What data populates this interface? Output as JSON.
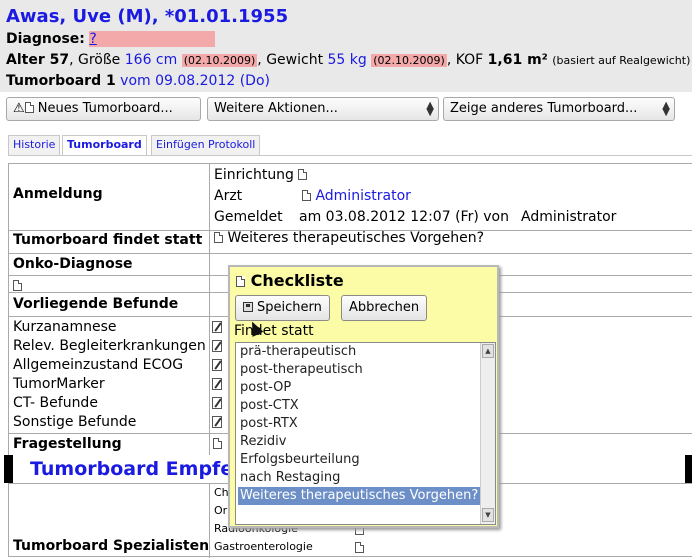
{
  "header": {
    "patient": "Awas, Uve (M), *01.01.1955",
    "diagnose_label": "Diagnose:",
    "diagnose_value": "?",
    "alter_label": "Alter 57",
    "groesse_label": ", Größe",
    "groesse_value": "166 cm",
    "groesse_date": "(02.10.2009)",
    "gewicht_label": ", Gewicht",
    "gewicht_value": "55 kg",
    "gewicht_date": "(02.10.2009)",
    "kof_label": ", KOF",
    "kof_value": "1,61 m²",
    "kof_note": "(basiert auf Realgewicht)",
    "tumorboard_label": "Tumorboard 1",
    "tumorboard_date": "vom 09.08.2012 (Do)"
  },
  "toolbar": {
    "new_board": "Neues Tumorboard...",
    "more_actions": "Weitere Aktionen...",
    "show_other": "Zeige anderes Tumorboard..."
  },
  "tabs": [
    "Historie",
    "Tumorboard",
    "Einfügen Protokoll"
  ],
  "table": {
    "anmeldung": "Anmeldung",
    "einrichtung": "Einrichtung",
    "arzt": "Arzt",
    "arzt_value": "Administrator",
    "gemeldet": "Gemeldet",
    "gemeldet_value": "am 03.08.2012 12:07 (Fr) von",
    "gemeldet_by": "Administrator",
    "findet_statt": "Tumorboard findet statt",
    "findet_statt_value": "Weiteres therapeutisches Vorgehen?",
    "onko": "Onko-Diagnose",
    "befunde": "Vorliegende Befunde",
    "befunde_items": [
      "Kurzanamnese",
      "Relev. Begleiterkrankungen",
      "Allgemeinzustand ECOG",
      "TumorMarker",
      "CT- Befunde",
      "Sonstige Befunde"
    ],
    "fragestellung": "Fragestellung",
    "empfehlung": "Tumorboard Empfel",
    "spezialisten": "Tumorboard Spezialisten",
    "spezialisten_items": [
      "Ch",
      "Or",
      "Radioonkologie",
      "Gastroenterologie"
    ]
  },
  "popup": {
    "title": "Checkliste",
    "save": "Speichern",
    "cancel": "Abbrechen",
    "label": "Findet statt",
    "options": [
      "prä-therapeutisch",
      "post-therapeutisch",
      "post-OP",
      "post-CTX",
      "post-RTX",
      "Rezidiv",
      "Erfolgsbeurteilung",
      "nach Restaging",
      "Weiteres therapeutisches Vorgehen?"
    ],
    "selected": "Weiteres therapeutisches Vorgehen?"
  }
}
